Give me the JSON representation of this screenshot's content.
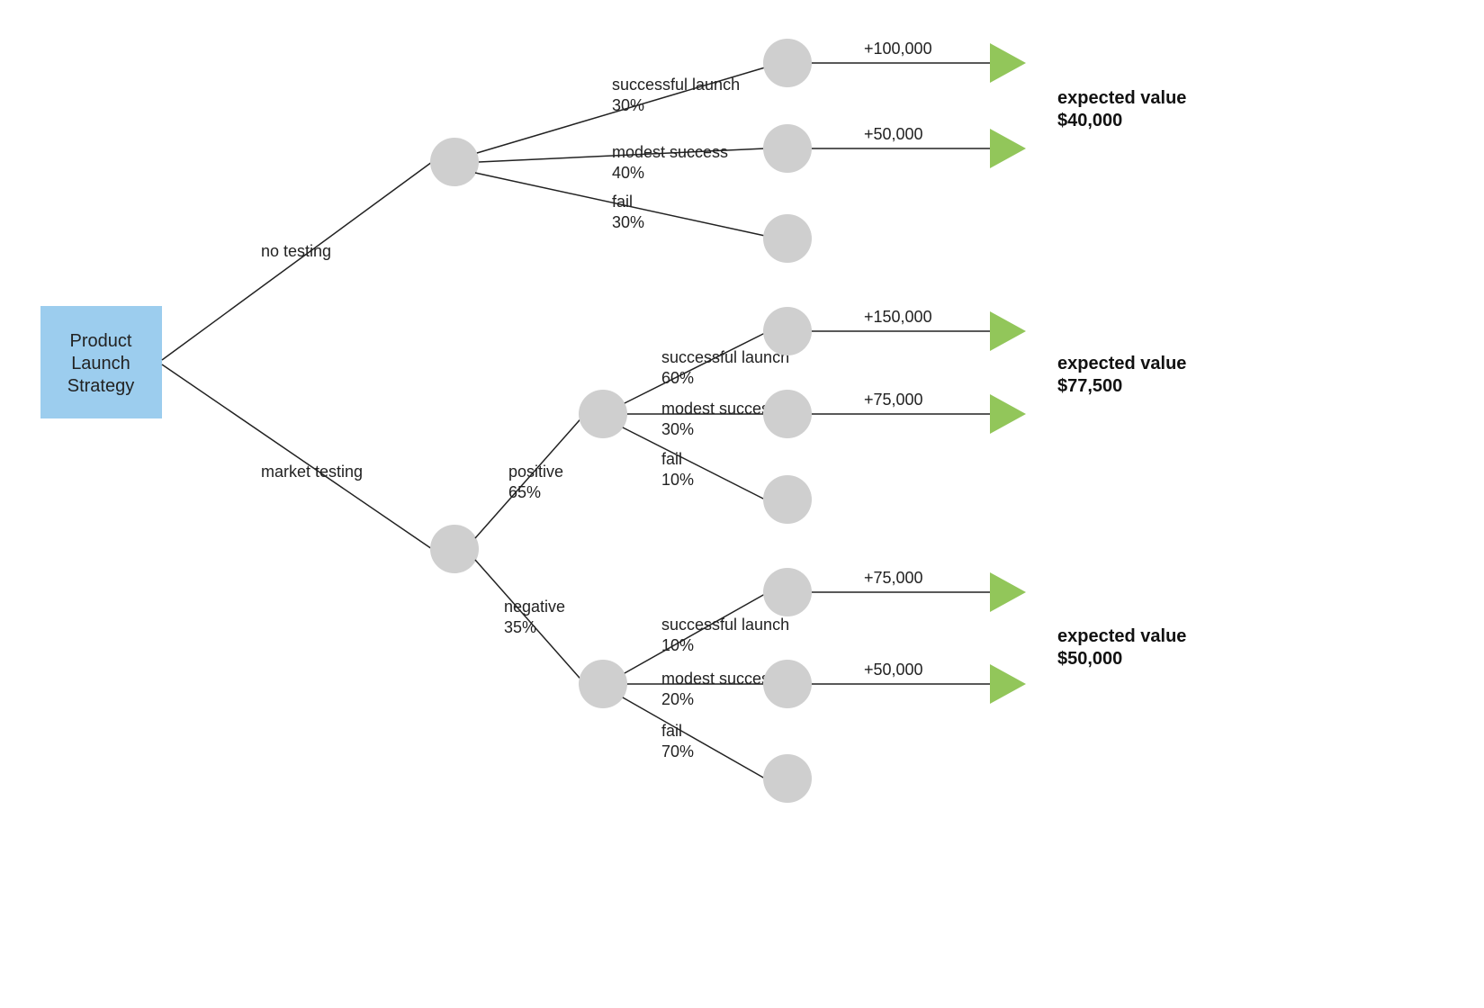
{
  "root": {
    "line1": "Product",
    "line2": "Launch",
    "line3": "Strategy"
  },
  "branches": {
    "no_testing": {
      "label": "no testing",
      "outcomes": {
        "success": {
          "label": "successful launch",
          "prob": "30%",
          "payoff": "+100,000"
        },
        "modest": {
          "label": "modest success",
          "prob": "40%",
          "payoff": "+50,000"
        },
        "fail": {
          "label": "fail",
          "prob": "30%"
        }
      },
      "expected": {
        "label": "expected value",
        "value": "$40,000"
      }
    },
    "market_testing": {
      "label": "market testing",
      "positive": {
        "label": "positive",
        "prob": "65%",
        "outcomes": {
          "success": {
            "label": "successful launch",
            "prob": "60%",
            "payoff": "+150,000"
          },
          "modest": {
            "label": "modest success",
            "prob": "30%",
            "payoff": "+75,000"
          },
          "fail": {
            "label": "fail",
            "prob": "10%"
          }
        },
        "expected": {
          "label": "expected value",
          "value": "$77,500"
        }
      },
      "negative": {
        "label": "negative",
        "prob": "35%",
        "outcomes": {
          "success": {
            "label": "successful launch",
            "prob": "10%",
            "payoff": "+75,000"
          },
          "modest": {
            "label": "modest success",
            "prob": "20%",
            "payoff": "+50,000"
          },
          "fail": {
            "label": "fail",
            "prob": "70%"
          }
        },
        "expected": {
          "label": "expected value",
          "value": "$50,000"
        }
      }
    }
  }
}
